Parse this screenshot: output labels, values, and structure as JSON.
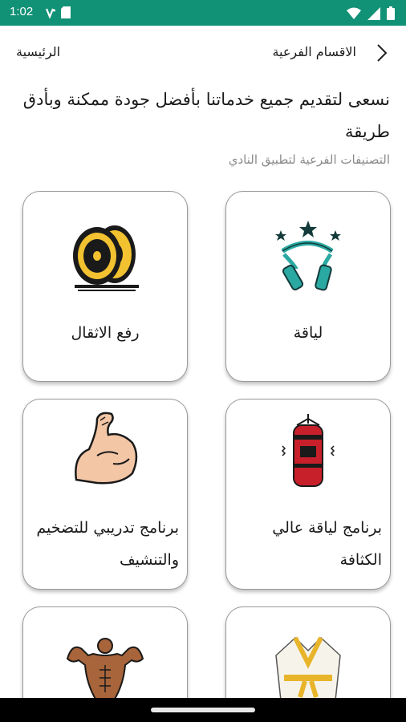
{
  "status_bar": {
    "time": "1:02",
    "bg_color": "#119175",
    "icons": [
      "volte-icon",
      "sim-card-icon",
      "wifi-icon",
      "cellular-signal-icon",
      "battery-icon"
    ]
  },
  "header": {
    "title": "الاقسام الفرعية",
    "home_link": "الرئيسية",
    "back_icon": "chevron-right-icon"
  },
  "intro": {
    "heading": "نسعى لتقديم جميع خدماتنا بأفضل جودة ممكنة وبأدق طريقة",
    "subtitle": "التصنيفات الفرعية لتطبيق النادي"
  },
  "categories": [
    {
      "label": "لياقة",
      "icon": "jump-rope-stars-icon"
    },
    {
      "label": "رفع الاثقال",
      "icon": "weight-plates-icon"
    },
    {
      "label": "برنامج لياقة عالي الكثافة",
      "icon": "punching-bag-icon"
    },
    {
      "label": "برنامج تدريبي للتضخيم والتنشيف",
      "icon": "flexed-bicep-icon"
    },
    {
      "label": "",
      "icon": "bodybuilder-icon"
    },
    {
      "label": "",
      "icon": "martial-arts-uniform-icon"
    }
  ]
}
